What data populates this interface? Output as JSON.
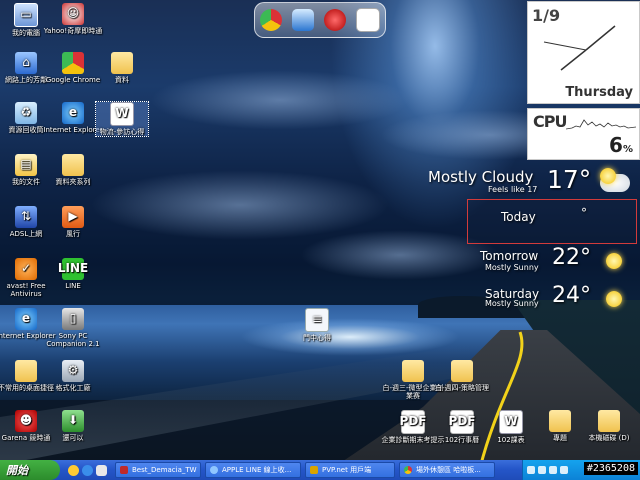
{
  "desktop_icons": [
    {
      "label": "我的電腦"
    },
    {
      "label": "Yahoo!奇摩即時通"
    },
    {
      "label": "網路上的芳鄰"
    },
    {
      "label": "Google Chrome"
    },
    {
      "label": "資料"
    },
    {
      "label": "資源回收筒"
    },
    {
      "label": "Internet Explorer"
    },
    {
      "label": "物流-參訪心得"
    },
    {
      "label": "我的文件"
    },
    {
      "label": "資料夾系列"
    },
    {
      "label": "ADSL上網"
    },
    {
      "label": "風行"
    },
    {
      "label": "avast! Free Antivirus"
    },
    {
      "label": "LINE"
    },
    {
      "label": "Internet Explorer"
    },
    {
      "label": "Sony PC Companion 2.1"
    },
    {
      "label": "不常用的桌面捷徑"
    },
    {
      "label": "格式化工廠"
    },
    {
      "label": "Garena 競時通"
    },
    {
      "label": "還可以"
    },
    {
      "label": "門中心得"
    },
    {
      "label": "白-週三-微型企業創業赛"
    },
    {
      "label": "白-週四-策略管理"
    },
    {
      "label": "企業診斷期末考提示"
    },
    {
      "label": "102行事曆"
    },
    {
      "label": "102課表"
    },
    {
      "label": "專題"
    },
    {
      "label": "本機磁碟 (D)"
    }
  ],
  "clock": {
    "date": "1/9",
    "day": "Thursday"
  },
  "cpu": {
    "label": "CPU",
    "value": "6",
    "unit": "%"
  },
  "weather": {
    "current": {
      "condition": "Mostly Cloudy",
      "feels": "Feels like 17",
      "temp": "17°"
    },
    "today": {
      "label": "Today",
      "temp": "°"
    },
    "tomorrow": {
      "label": "Tomorrow",
      "condition": "Mostly Sunny",
      "temp": "22°"
    },
    "saturday": {
      "label": "Saturday",
      "condition": "Mostly Sunny",
      "temp": "24°"
    }
  },
  "taskbar": {
    "start_label": "開始",
    "tasks": [
      {
        "label": "Best_Demacia_TW"
      },
      {
        "label": "APPLE LINE 線上收..."
      },
      {
        "label": "PVP.net 用戶端"
      },
      {
        "label": "場外休憩區 哈啦板..."
      }
    ]
  },
  "watermark": "#2365208"
}
